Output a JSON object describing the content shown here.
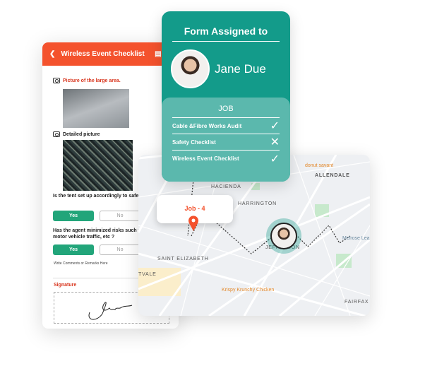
{
  "form": {
    "title": "Wireless Event Checklist",
    "picture_label": "Picture of the large area.",
    "detail_label": "Detailed picture",
    "q1": "Is the tent set up accordingly to safety guidelines ?",
    "q2": "Has the agent minimized risks such trip hazards, motor vehicle traffic, etc ?",
    "yes": "Yes",
    "no": "No",
    "comments": "Write Comments or Remarks Here",
    "signature": "Signature"
  },
  "assigned": {
    "title": "Form Assigned to",
    "name": "Jane Due",
    "job_heading": "JOB",
    "jobs": [
      {
        "label": "Cable &Fibre Works Audit",
        "status": "done",
        "mark": "✓"
      },
      {
        "label": "Safety Checklist",
        "status": "failed",
        "mark": "✕"
      },
      {
        "label": "Wireless Event Checklist",
        "status": "done",
        "mark": "✓"
      }
    ]
  },
  "map": {
    "popup": "Job - 4",
    "labels": [
      "ALLENDALE",
      "HACIENDA",
      "HARRINGTON",
      "SAINT ELIZABETH",
      "TVALE",
      "FAIRFAX",
      "JEFFERSON"
    ],
    "places": [
      "donut savant",
      "Krispy Krunchy Chicken",
      "Melrose Lea"
    ]
  },
  "colors": {
    "accent": "#f4522d",
    "teal": "#139b8a",
    "teal_light": "#5bb8ad",
    "green": "#22a57a"
  }
}
